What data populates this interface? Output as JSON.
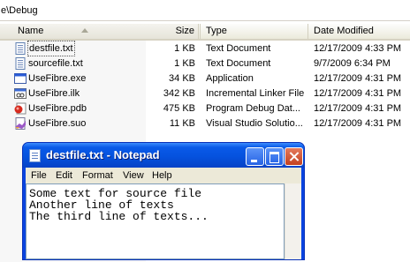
{
  "explorer": {
    "address": "e\\Debug",
    "columns": {
      "name": "Name",
      "size": "Size",
      "type": "Type",
      "date": "Date Modified"
    },
    "files": [
      {
        "name": "destfile.txt",
        "size": "1 KB",
        "type": "Text Document",
        "date": "12/17/2009 4:33 PM",
        "icon": "text-file-icon"
      },
      {
        "name": "sourcefile.txt",
        "size": "1 KB",
        "type": "Text Document",
        "date": "9/7/2009 6:34 PM",
        "icon": "text-file-icon"
      },
      {
        "name": "UseFibre.exe",
        "size": "34 KB",
        "type": "Application",
        "date": "12/17/2009 4:31 PM",
        "icon": "application-icon"
      },
      {
        "name": "UseFibre.ilk",
        "size": "342 KB",
        "type": "Incremental Linker File",
        "date": "12/17/2009 4:31 PM",
        "icon": "linker-file-icon"
      },
      {
        "name": "UseFibre.pdb",
        "size": "475 KB",
        "type": "Program Debug Dat...",
        "date": "12/17/2009 4:31 PM",
        "icon": "debug-database-icon"
      },
      {
        "name": "UseFibre.suo",
        "size": "11 KB",
        "type": "Visual Studio Solutio...",
        "date": "12/17/2009 4:31 PM",
        "icon": "visual-studio-icon"
      }
    ]
  },
  "notepad": {
    "title": "destfile.txt - Notepad",
    "menu": [
      "File",
      "Edit",
      "Format",
      "View",
      "Help"
    ],
    "lines": [
      "Some text for source file",
      "Another line of texts",
      "The third line of texts..."
    ],
    "accent": "#0552de"
  }
}
